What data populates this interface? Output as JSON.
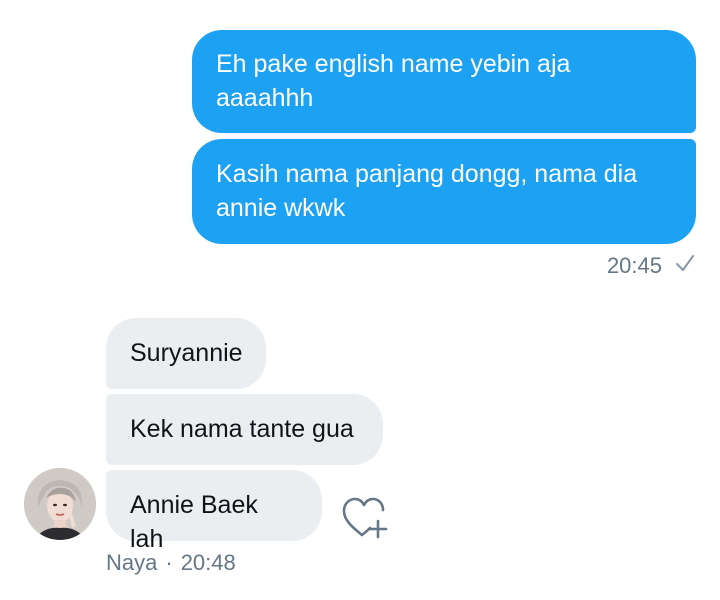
{
  "conversation": {
    "outgoing": {
      "messages": [
        "Eh pake english name yebin aja\naaaahhh",
        "Kasih nama panjang dongg, nama dia\nannie wkwk"
      ],
      "time": "20:45",
      "status_icon": "check-icon"
    },
    "incoming": {
      "messages": [
        "Suryannie",
        "Kek nama tante gua",
        "Annie Baek lah"
      ],
      "sender": "Naya",
      "separator": "·",
      "time": "20:48",
      "react_icon": "heart-plus-icon"
    }
  },
  "colors": {
    "outgoing_bubble": "#1da1f2",
    "incoming_bubble": "#ebeef0",
    "meta_text": "#657786"
  }
}
